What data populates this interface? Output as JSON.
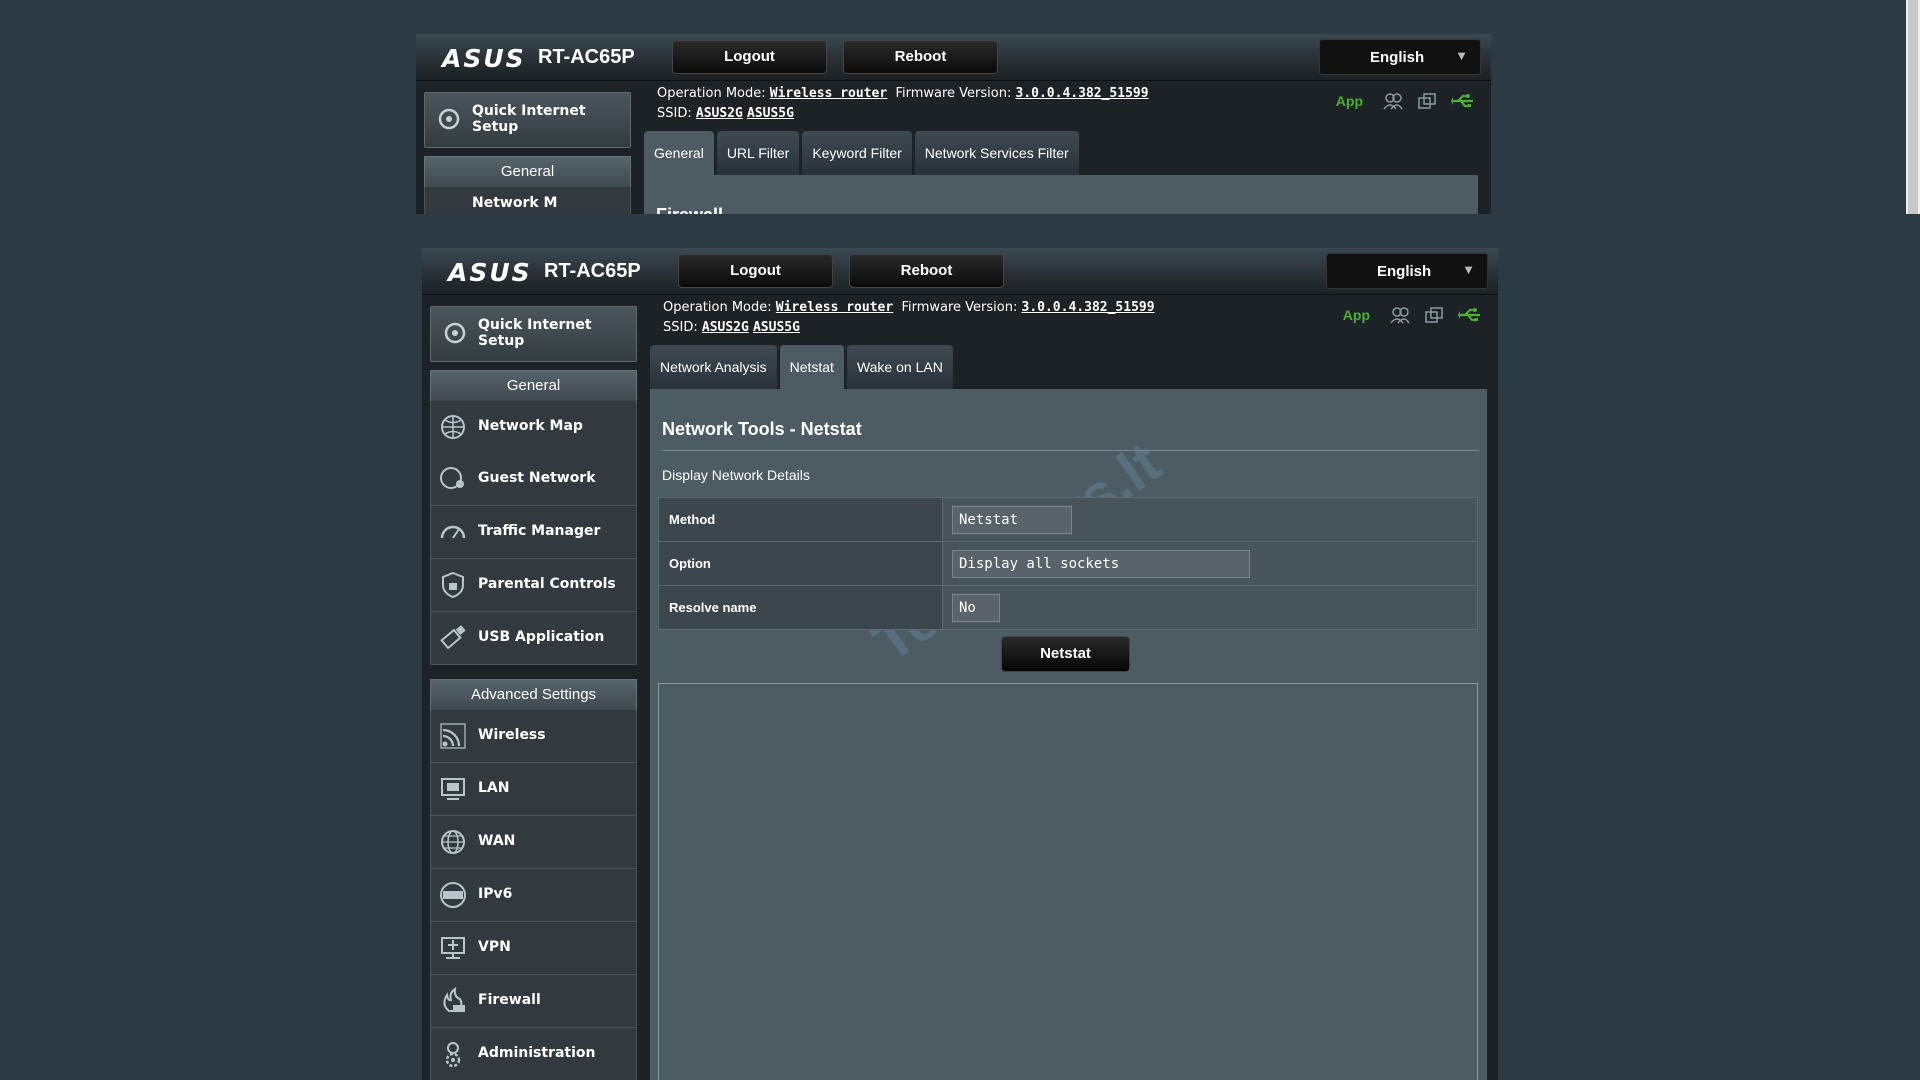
{
  "router": {
    "brand": "ASUS",
    "model": "RT-AC65P",
    "logout": "Logout",
    "reboot": "Reboot",
    "language": "English",
    "op_mode_label": "Operation Mode:",
    "op_mode_value": "Wireless router",
    "fw_label": "Firmware Version:",
    "fw_value": "3.0.0.4.382_51599",
    "ssid_label": "SSID:",
    "ssid_2g": "ASUS2G",
    "ssid_5g": "ASUS5G",
    "app_label": "App"
  },
  "top_window": {
    "quick_setup": "Quick Internet Setup",
    "general_header": "General",
    "partial_item": "Network M",
    "tabs": [
      "General",
      "URL Filter",
      "Keyword Filter",
      "Network Services Filter"
    ],
    "content_partial_title": "Firewall"
  },
  "sidebar": {
    "quick_setup": "Quick Internet Setup",
    "general_header": "General",
    "general_items": [
      {
        "label": "Network Map",
        "icon": "network-map-icon"
      },
      {
        "label": "Guest Network",
        "icon": "guest-network-icon"
      },
      {
        "label": "Traffic Manager",
        "icon": "traffic-manager-icon"
      },
      {
        "label": "Parental Controls",
        "icon": "parental-controls-icon"
      },
      {
        "label": "USB Application",
        "icon": "usb-application-icon"
      }
    ],
    "advanced_header": "Advanced Settings",
    "advanced_items": [
      {
        "label": "Wireless",
        "icon": "wireless-icon"
      },
      {
        "label": "LAN",
        "icon": "lan-icon"
      },
      {
        "label": "WAN",
        "icon": "wan-icon"
      },
      {
        "label": "IPv6",
        "icon": "ipv6-icon"
      },
      {
        "label": "VPN",
        "icon": "vpn-icon"
      },
      {
        "label": "Firewall",
        "icon": "firewall-icon"
      },
      {
        "label": "Administration",
        "icon": "administration-icon"
      }
    ]
  },
  "main": {
    "tabs": [
      "Network Analysis",
      "Netstat",
      "Wake on LAN"
    ],
    "active_tab": "Netstat",
    "title": "Network Tools - Netstat",
    "subtitle": "Display Network Details",
    "form": {
      "method_label": "Method",
      "method_value": "Netstat",
      "option_label": "Option",
      "option_value": "Display all sockets",
      "resolve_label": "Resolve name",
      "resolve_value": "No"
    },
    "run_button": "Netstat",
    "output": ""
  },
  "watermark": "TechNews.lt",
  "colors": {
    "accent_green": "#4caf2f",
    "content_bg": "#4d5c63",
    "page_bg": "#2b3a43"
  }
}
